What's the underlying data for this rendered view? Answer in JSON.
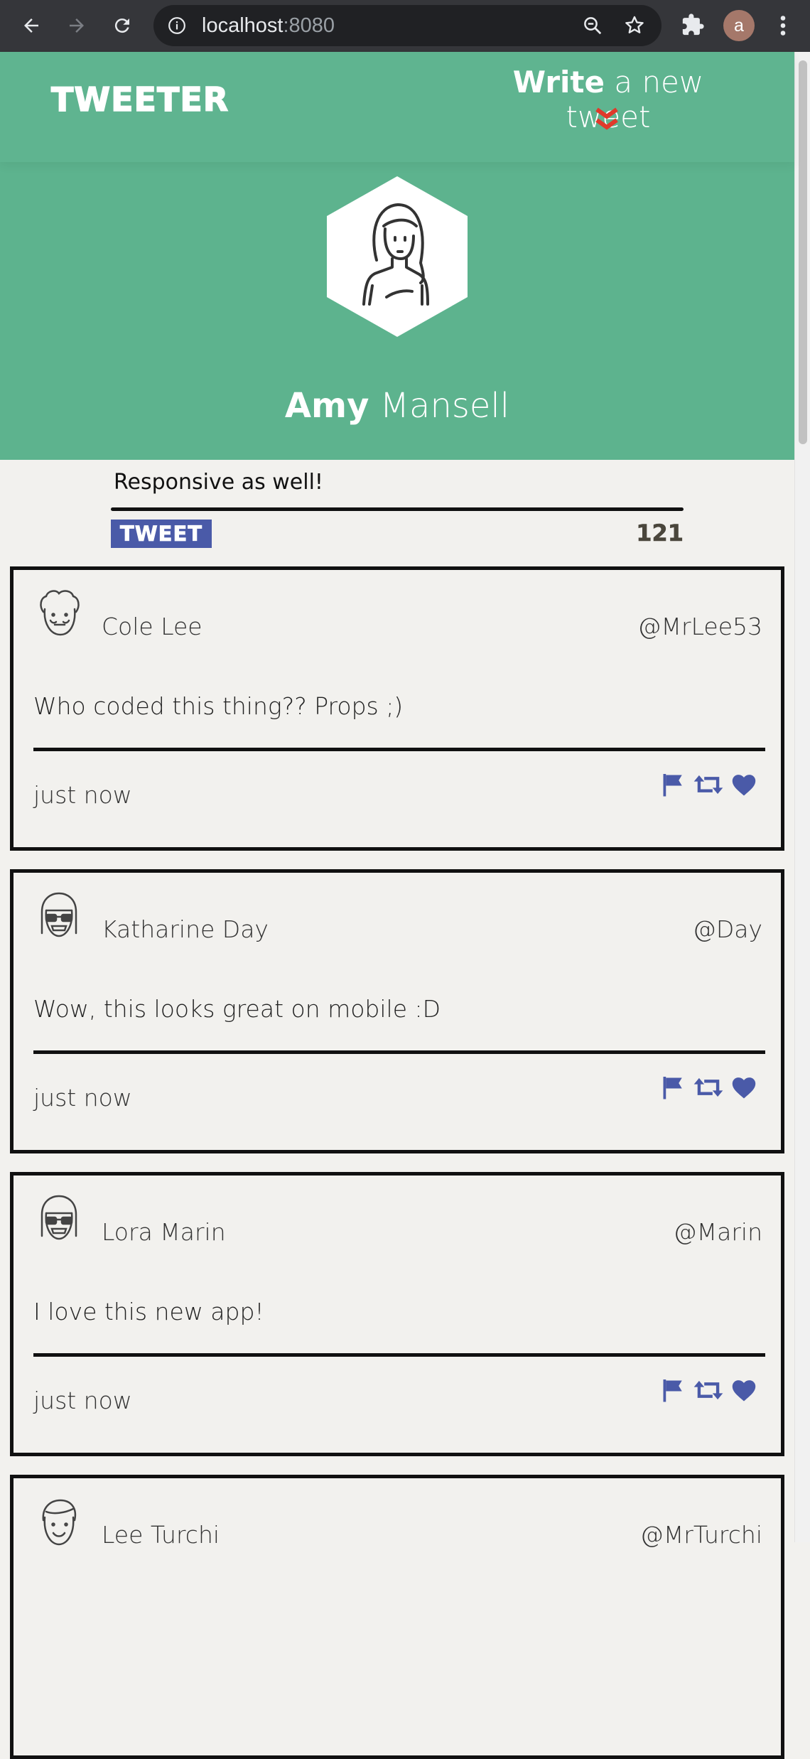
{
  "browser": {
    "url_host": "localhost",
    "url_port": ":8080",
    "profile_initial": "a"
  },
  "header": {
    "logo": "TWEETER",
    "compose_bold": "Write",
    "compose_rest": " a new tweet",
    "user_first": "Amy",
    "user_last": " Mansell"
  },
  "composer": {
    "text": "Responsive as well!",
    "button": "TWEET",
    "counter": "121"
  },
  "tweets": [
    {
      "name": "Cole Lee",
      "handle": "@MrLee53",
      "content": "Who coded this thing?? Props ;)",
      "time": "just now",
      "avatar": "curly-hair-man-avatar"
    },
    {
      "name": "Katharine Day",
      "handle": "@Day",
      "content": "Wow, this looks great on mobile :D",
      "time": "just now",
      "avatar": "glasses-woman-avatar"
    },
    {
      "name": "Lora Marin",
      "handle": "@Marin",
      "content": "I love this new app!",
      "time": "just now",
      "avatar": "glasses-woman-avatar"
    },
    {
      "name": "Lee Turchi",
      "handle": "@MrTurchi",
      "content": "",
      "time": "",
      "avatar": "smiling-man-avatar"
    }
  ],
  "colors": {
    "header_green": "#5db38e",
    "accent_blue": "#4a5aa8",
    "chevron_red": "#e0392b",
    "page_bg": "#f2f1ee"
  },
  "icons": {
    "flag": "flag-icon",
    "retweet": "retweet-icon",
    "like": "heart-icon"
  }
}
